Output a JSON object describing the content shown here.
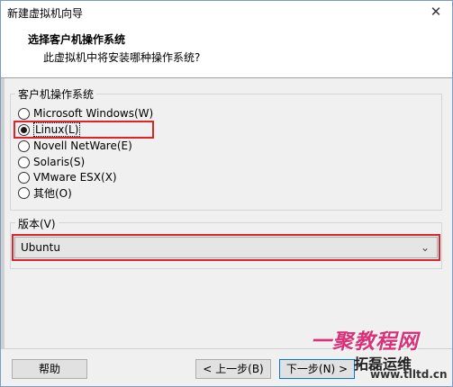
{
  "window": {
    "title": "新建虚拟机向导",
    "close_glyph": "✕"
  },
  "header": {
    "title": "选择客户机操作系统",
    "subtitle": "此虚拟机中将安装哪种操作系统?"
  },
  "guest_os": {
    "legend": "客户机操作系统",
    "options": [
      {
        "label": "Microsoft Windows(W)",
        "checked": false
      },
      {
        "label": "Linux(L)",
        "checked": true
      },
      {
        "label": "Novell NetWare(E)",
        "checked": false
      },
      {
        "label": "Solaris(S)",
        "checked": false
      },
      {
        "label": "VMware ESX(X)",
        "checked": false
      },
      {
        "label": "其他(O)",
        "checked": false
      }
    ]
  },
  "version": {
    "legend": "版本(V)",
    "selected": "Ubuntu",
    "icon": "chevron-down-icon"
  },
  "buttons": {
    "help": "帮助",
    "back": "< 上一步(B)",
    "next": "下一步(N) >"
  },
  "watermark": {
    "main": "一聚教程网",
    "brand": "拓磊运维",
    "url": "www.tlltd.cn"
  },
  "colors": {
    "highlight": "#e0232b",
    "accent": "#0078d7"
  }
}
